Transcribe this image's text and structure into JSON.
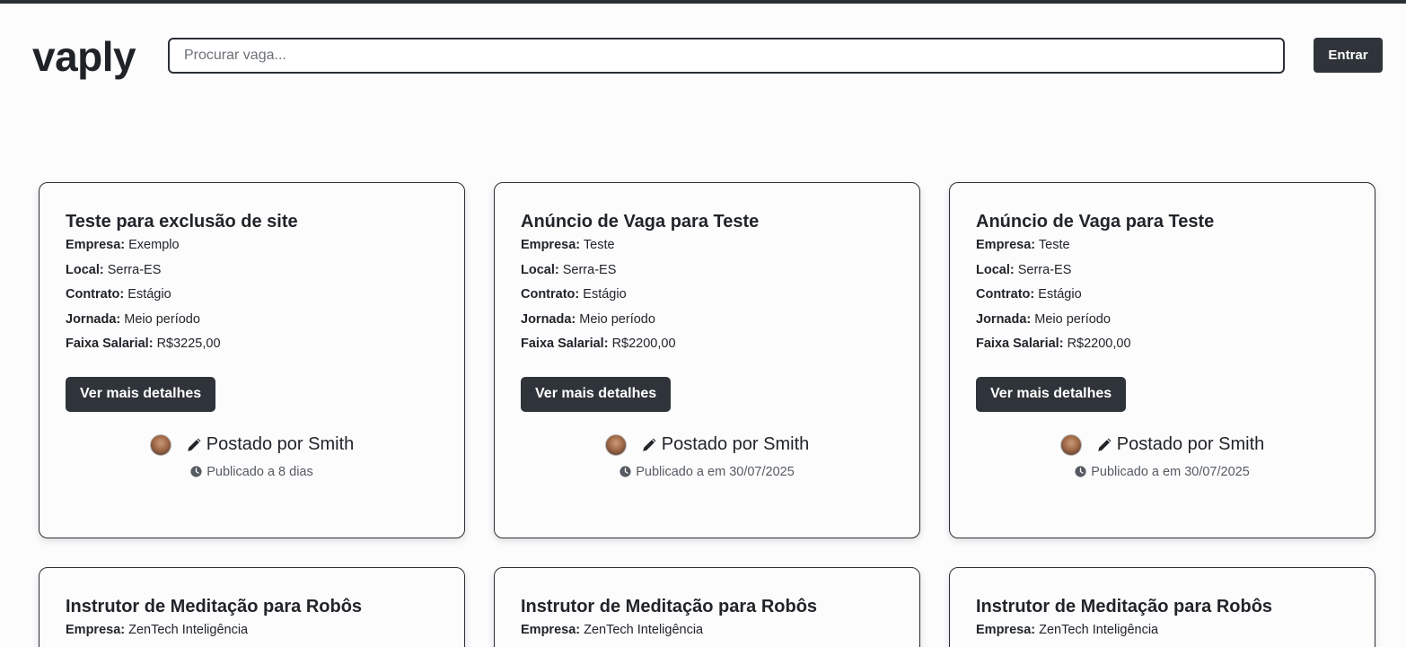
{
  "header": {
    "logo": "vaply",
    "search_placeholder": "Procurar vaga...",
    "login_label": "Entrar"
  },
  "labels": {
    "company": "Empresa:",
    "location": "Local:",
    "contract": "Contrato:",
    "schedule": "Jornada:",
    "salary": "Faixa Salarial:",
    "details_button": "Ver mais detalhes"
  },
  "jobs": [
    {
      "title": "Teste para exclusão de site",
      "company": "Exemplo",
      "location": "Serra-ES",
      "contract": "Estágio",
      "schedule": "Meio período",
      "salary": "R$3225,00",
      "posted_by": "Postado por Smith",
      "published": "Publicado a 8 dias"
    },
    {
      "title": "Anúncio de Vaga para Teste",
      "company": "Teste",
      "location": "Serra-ES",
      "contract": "Estágio",
      "schedule": "Meio período",
      "salary": "R$2200,00",
      "posted_by": "Postado por Smith",
      "published": "Publicado a em 30/07/2025"
    },
    {
      "title": "Anúncio de Vaga para Teste",
      "company": "Teste",
      "location": "Serra-ES",
      "contract": "Estágio",
      "schedule": "Meio período",
      "salary": "R$2200,00",
      "posted_by": "Postado por Smith",
      "published": "Publicado a em 30/07/2025"
    },
    {
      "title": "Instrutor de Meditação para Robôs",
      "company": "ZenTech Inteligência"
    },
    {
      "title": "Instrutor de Meditação para Robôs",
      "company": "ZenTech Inteligência"
    },
    {
      "title": "Instrutor de Meditação para Robôs",
      "company": "ZenTech Inteligência"
    }
  ],
  "icons": {
    "avatar": "user-avatar",
    "edit": "pencil-icon",
    "time": "clock-icon"
  },
  "colors": {
    "primary_dark": "#2f343a",
    "background": "#fcfcfd",
    "text": "#212529"
  }
}
